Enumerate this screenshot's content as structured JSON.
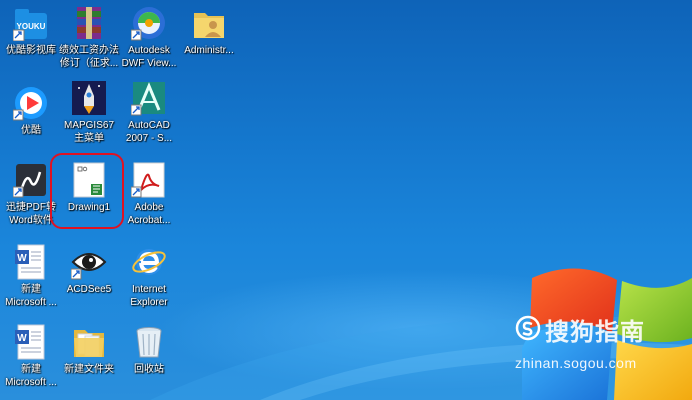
{
  "desktop": {
    "icons": [
      {
        "label": "优酷影视库"
      },
      {
        "label": "绩效工资办法\n修订（征求..."
      },
      {
        "label": "Autodesk\nDWF View..."
      },
      {
        "label": "Administr..."
      },
      {
        "label": "优酷"
      },
      {
        "label": "MAPGIS67\n主菜单"
      },
      {
        "label": "AutoCAD\n2007 - S..."
      },
      {
        "label": "迅捷PDF转\nWord软件"
      },
      {
        "label": "Drawing1"
      },
      {
        "label": "Adobe\nAcrobat..."
      },
      {
        "label": "新建\nMicrosoft ..."
      },
      {
        "label": "ACDSee5"
      },
      {
        "label": "Internet\nExplorer"
      },
      {
        "label": "新建\nMicrosoft ..."
      },
      {
        "label": "新建文件夹"
      },
      {
        "label": "回收站"
      }
    ],
    "youku_badge": "YOUKU"
  },
  "watermark": {
    "brand": "搜狗指南",
    "url": "zhinan.sogou.com"
  },
  "colors": {
    "highlight": "#e01222",
    "desktop_top": "#0e63b8",
    "desktop_bottom": "#2a8fdc"
  }
}
